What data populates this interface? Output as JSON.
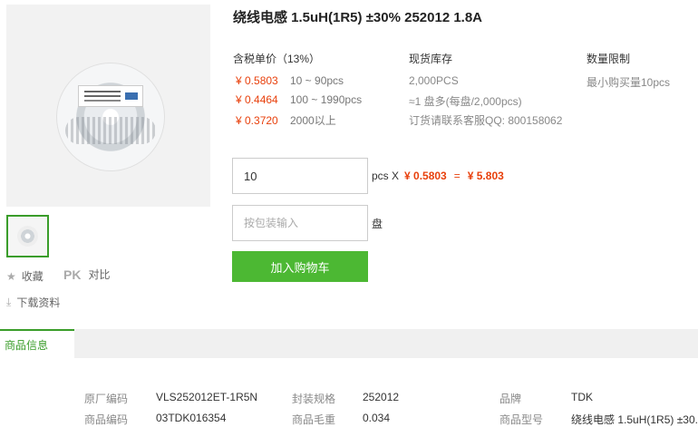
{
  "product": {
    "title": "绕线电感 1.5uH(1R5) ±30% 252012 1.8A"
  },
  "sidebar": {
    "favorite": "收藏",
    "pk": "PK",
    "compare": "对比",
    "download": "下载资料"
  },
  "pricing": {
    "header": "含税单价（13%）",
    "tiers": [
      {
        "price": "¥ 0.5803",
        "range": "10 ~ 90pcs"
      },
      {
        "price": "¥ 0.4464",
        "range": "100 ~ 1990pcs"
      },
      {
        "price": "¥ 0.3720",
        "range": "2000以上"
      }
    ]
  },
  "stock": {
    "header": "现货库存",
    "lines": [
      "2,000PCS",
      "≈1 盘多(每盘/2,000pcs)",
      "订货请联系客服QQ: 800158062"
    ]
  },
  "limit": {
    "header": "数量限制",
    "text": "最小购买量10pcs"
  },
  "order": {
    "quantity_value": "10",
    "unit_label": "pcs X",
    "unit_price": "¥ 0.5803",
    "equals": "=",
    "total": "¥ 5.803",
    "reel_placeholder": "按包装输入",
    "reel_unit": "盘",
    "add_to_cart": "加入购物车"
  },
  "tabs": {
    "active": "商品信息"
  },
  "specs": [
    {
      "label": "原厂编码",
      "value": "VLS252012ET-1R5N"
    },
    {
      "label": "封装规格",
      "value": "252012"
    },
    {
      "label": "品牌",
      "value": "TDK"
    },
    {
      "label": "商品编码",
      "value": "03TDK016354"
    },
    {
      "label": "商品毛重",
      "value": "0.034"
    },
    {
      "label": "商品型号",
      "value": "绕线电感 1.5uH(1R5) ±30."
    }
  ],
  "colors": {
    "price": "#e8400c",
    "accent": "#3a9d2a",
    "button": "#4cb833"
  }
}
